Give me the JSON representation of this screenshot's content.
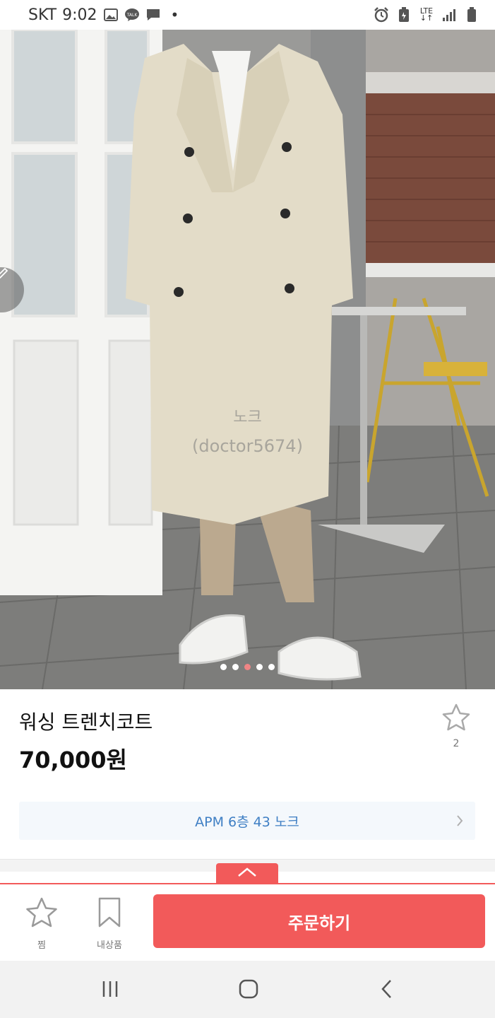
{
  "status_bar": {
    "carrier": "SKT",
    "time": "9:02",
    "network": "LTE",
    "left_icons": [
      "gallery-icon",
      "kakaotalk-icon",
      "message-icon"
    ],
    "right_icons": [
      "alarm-icon",
      "battery-saver-icon",
      "lte-icon",
      "signal-icon",
      "battery-icon"
    ]
  },
  "product_image": {
    "watermark_store": "노크",
    "watermark_id": "(doctor5674)",
    "carousel": {
      "count": 5,
      "active_index": 2
    }
  },
  "product": {
    "title": "워싱 트렌치코트",
    "price": "70,000원",
    "favorite_count": "2"
  },
  "store": {
    "location": "APM 6층 43 노크"
  },
  "action_bar": {
    "wishlist_label": "찜",
    "my_items_label": "내상품",
    "order_label": "주문하기"
  },
  "colors": {
    "accent": "#f25a5a",
    "store_link": "#3f7fc4",
    "active_dot": "#f08585"
  }
}
